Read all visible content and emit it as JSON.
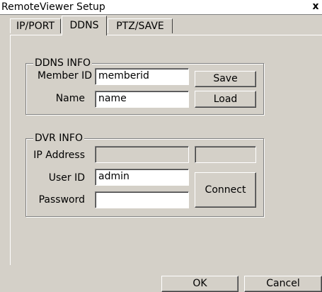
{
  "window": {
    "title": "RemoteViewer Setup",
    "close_glyph": "x"
  },
  "tabs": [
    {
      "label": "IP/PORT",
      "active": false
    },
    {
      "label": "DDNS",
      "active": true
    },
    {
      "label": "PTZ/SAVE",
      "active": false
    }
  ],
  "ddns": {
    "legend": "DDNS INFO",
    "member_id_label": "Member ID",
    "member_id_value": "memberid",
    "name_label": "Name",
    "name_value": "name",
    "save_label": "Save",
    "load_label": "Load"
  },
  "dvr": {
    "legend": "DVR INFO",
    "ip_label": "IP Address",
    "ip_value": "",
    "ip_extra_value": "",
    "user_id_label": "User ID",
    "user_id_value": "admin",
    "password_label": "Password",
    "password_value": "",
    "connect_label": "Connect"
  },
  "footer": {
    "ok_label": "OK",
    "cancel_label": "Cancel"
  }
}
